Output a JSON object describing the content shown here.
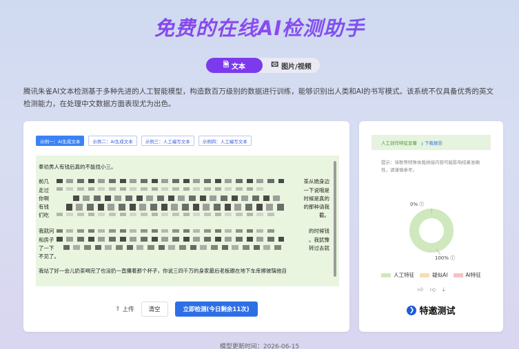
{
  "title": "免费的在线AI检测助手",
  "tabs": [
    {
      "label": "文本",
      "icon": "document-icon",
      "active": true
    },
    {
      "label": "图片/视频",
      "icon": "image-icon",
      "active": false
    }
  ],
  "description": "腾讯朱雀AI文本检测基于多种先进的人工智能模型，构造数百万级别的数据进行训练，能够识别出人类和AI的书写模式。该系统不仅具备优秀的英文检测能力，在处理中文数据方面表现尤为出色。",
  "examples": [
    "示例一：AI生成文本",
    "示例二：AI生成文本",
    "示例三：人工编写文本",
    "示例四：人工编写文本"
  ],
  "input_text": {
    "line1": "奉劝男人有钱后真的不能找小三。",
    "p1_lines": [
      "前几",
      "走过",
      "你啊",
      "有钱",
      "们吃"
    ],
    "p1_right": [
      "茶从她身边",
      "一下说哦是",
      "时候是真的",
      "的那种请我",
      "截。"
    ],
    "p2_lines": [
      "我就问",
      "和房子",
      "了一下",
      "不见了。"
    ],
    "p2_right": [
      "的时候钱",
      "。我犹豫",
      "转过去就"
    ],
    "last": "我站了好一会儿奶茶喝完了也没扔一直攥着那个杯子，你说三四千万的身家最后老板跟在地下车库擦玻璃他自"
  },
  "actions": {
    "upload": "上传",
    "clear": "清空",
    "detect": "立即检测(今日剩余11次)"
  },
  "result": {
    "header": "人工创作特征显著",
    "download": "下载报告",
    "hint": "提示：诗歌等特殊体裁拼接内容可能影响结果准确性，请谨慎参考。",
    "top_label": "0%",
    "bottom_label": "100%",
    "human_percent": 100,
    "legend": [
      {
        "label": "人工特征",
        "color": "#cfe8bd"
      },
      {
        "label": "疑似AI",
        "color": "#f7dcb5"
      },
      {
        "label": "AI特征",
        "color": "#f5c2c2"
      }
    ],
    "brand": "特邀测试"
  },
  "footer": "模型更新时间：2026-06-15"
}
